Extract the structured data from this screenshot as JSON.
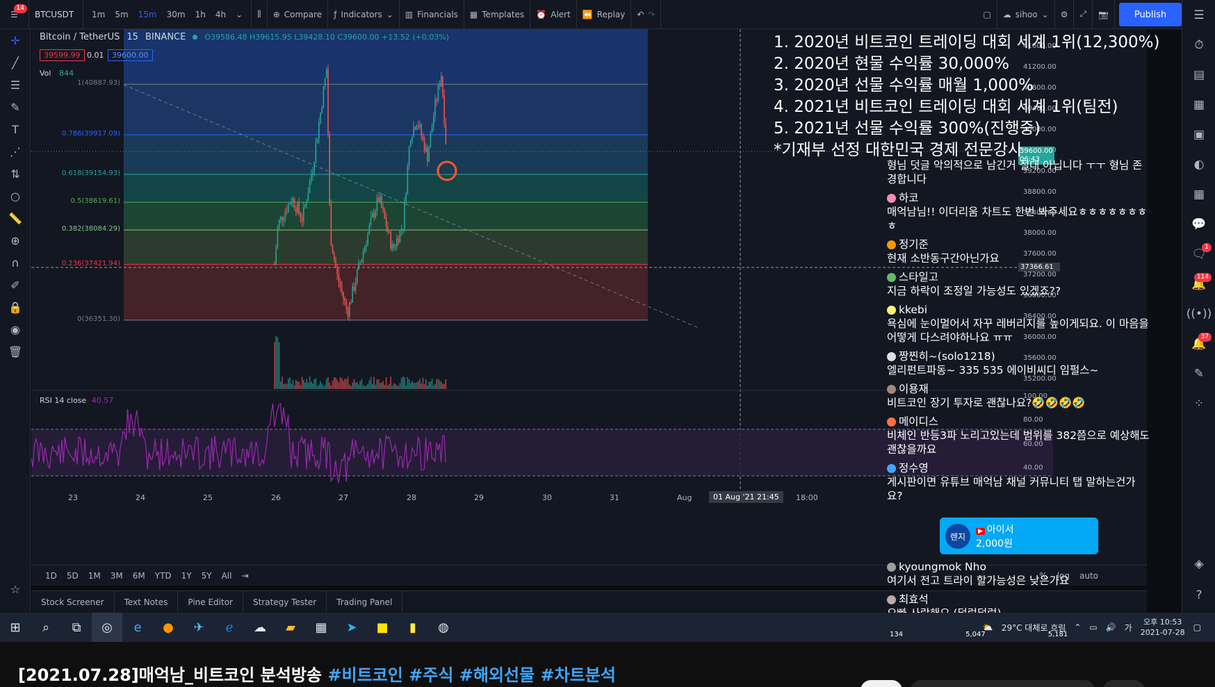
{
  "topbar": {
    "symbol": "BTCUSDT",
    "timeframes": [
      "1m",
      "5m",
      "15m",
      "30m",
      "1h",
      "4h"
    ],
    "active_timeframe": "15m",
    "compare_label": "Compare",
    "indicators_label": "Indicators",
    "financials_label": "Financials",
    "templates_label": "Templates",
    "alert_label": "Alert",
    "replay_label": "Replay",
    "layout_name": "sihoo",
    "publish_label": "Publish",
    "menu_badge": "14"
  },
  "legend": {
    "title": "Bitcoin / TetherUS",
    "interval": "15",
    "exchange": "BINANCE",
    "ohlc": "O39586.48 H39615.95 L39428.10 C39600.00 +13.52 (+0.03%)",
    "bid": "39599.99",
    "spread": "0.01",
    "ask": "39600.00",
    "vol_label": "Vol",
    "vol_value": "844",
    "rsi_label": "RSI 14 close",
    "rsi_value": "40.57"
  },
  "fib_levels": [
    {
      "label": "1(40887.93)",
      "color": "#787b86"
    },
    {
      "label": "0.786(39917.09)",
      "color": "#2962ff"
    },
    {
      "label": "0.618(39154.93)",
      "color": "#26a69a"
    },
    {
      "label": "0.5(38619.61)",
      "color": "#4caf50"
    },
    {
      "label": "0.382(38084.29)",
      "color": "#81c784"
    },
    {
      "label": "0.236(37421.94)",
      "color": "#f23645"
    },
    {
      "label": "0(36351.30)",
      "color": "#787b86"
    }
  ],
  "price_axis": [
    "41600.00",
    "41200.00",
    "40800.00",
    "40400.00",
    "40000.00",
    "39600.00",
    "39200.00",
    "38800.00",
    "38400.00",
    "38000.00",
    "37600.00",
    "37200.00",
    "36800.00",
    "36400.00",
    "36000.00",
    "35600.00",
    "35200.00"
  ],
  "current_price": "39600.00",
  "countdown": "06:43",
  "crosshair_price": "37366.61",
  "rsi_axis": [
    "100.00",
    "80.00",
    "60.00",
    "40.00"
  ],
  "time_axis": [
    "23",
    "24",
    "25",
    "26",
    "27",
    "28",
    "29",
    "30",
    "31",
    "Aug",
    "18:00"
  ],
  "crosshair_time": "01 Aug '21  21:45",
  "ranges": [
    "1D",
    "5D",
    "1M",
    "3M",
    "6M",
    "YTD",
    "1Y",
    "5Y",
    "All"
  ],
  "range_right": [
    "%",
    "log",
    "auto"
  ],
  "bottom_tabs": [
    "Stock Screener",
    "Text Notes",
    "Pine Editor",
    "Strategy Tester",
    "Trading Panel"
  ],
  "achievements": [
    "1. 2020년 비트코인 트레이딩 대회 세계 1위(12,300%)",
    "2. 2020년 현물 수익률 30,000%",
    "3. 2020년 선물 수익률 매월 1,000%",
    "4. 2021년 비트코인 트레이딩 대회 세계 1위(팀전)",
    "5. 2021년 선물 수익률 300%(진행중)",
    "*기재부 선정 대한민국 경제 전문강사"
  ],
  "chat": [
    {
      "author": "",
      "text": "형님 덧글 악의적으로 남긴거 절대 아닙니다 ㅜㅜ 형님 존경합니다",
      "color": ""
    },
    {
      "author": "하코",
      "text": "매억남님!! 이더리움 차트도 한번 봐주세요ㅎㅎㅎㅎㅎㅎㅎㅎ",
      "color": "#f48fb1"
    },
    {
      "author": "정기준",
      "text": "현재 소반동구간아닌가요",
      "color": "#ff9800"
    },
    {
      "author": "스타일고",
      "text": "지금 하락이 조정일 가능성도 있겠죠??",
      "color": "#66bb6a"
    },
    {
      "author": "kkebi",
      "text": "욕심에 눈이멀어서 자꾸 레버리지를 높이게되요. 이 마음을 어떻게 다스려야하나요 ㅠㅠ",
      "color": "#fff176"
    },
    {
      "author": "짱찐히~(solo1218)",
      "text": "엘리펀트파동~ 335 535 에이비씨디 임펄스~",
      "color": "#e0e0e0"
    },
    {
      "author": "이용재",
      "text": "비트코인 장기 투자로 괜찮나요?🤣🤣🤣🤣",
      "color": "#a1887f"
    },
    {
      "author": "메이디스",
      "text": "비체인 반등3파 노리고있는데 범위를 382쯤으로 예상해도괜찮을까요",
      "color": "#ff7043"
    },
    {
      "author": "정수영",
      "text": "게시판이면 유튜브 매억남 채널 커뮤니티 탭 말하는건가요?",
      "color": "#42a5f5"
    }
  ],
  "donation": {
    "avatar_text": "렌지",
    "name": "아이서",
    "amount": "2,000원"
  },
  "chat_after": [
    {
      "author": "kyoungmok Nho",
      "text": "여기서 전고 트라이 할가능성은 낮은가요",
      "color": "#9e9e9e"
    },
    {
      "author": "최효석",
      "text": "오빠 사랑해요 (덜렁덜렁)",
      "color": "#bcaaa4"
    }
  ],
  "right_badges": [
    "1",
    "114",
    "37"
  ],
  "taskbar": {
    "weather": "29°C 대체로 흐림",
    "clock_time": "오후 10:53",
    "clock_date": "2021-07-28",
    "counts": [
      "134",
      "5,047",
      "5,181"
    ]
  },
  "video_title": {
    "main": "[2021.07.28]매억남_비트코인 분석방송 ",
    "tags": "#비트코인 #주식 #해외선물 #차트분석"
  },
  "colors": {
    "accent": "#2962ff",
    "up": "#26a69a",
    "down": "#ef5350",
    "rsi": "#9c27b0"
  }
}
